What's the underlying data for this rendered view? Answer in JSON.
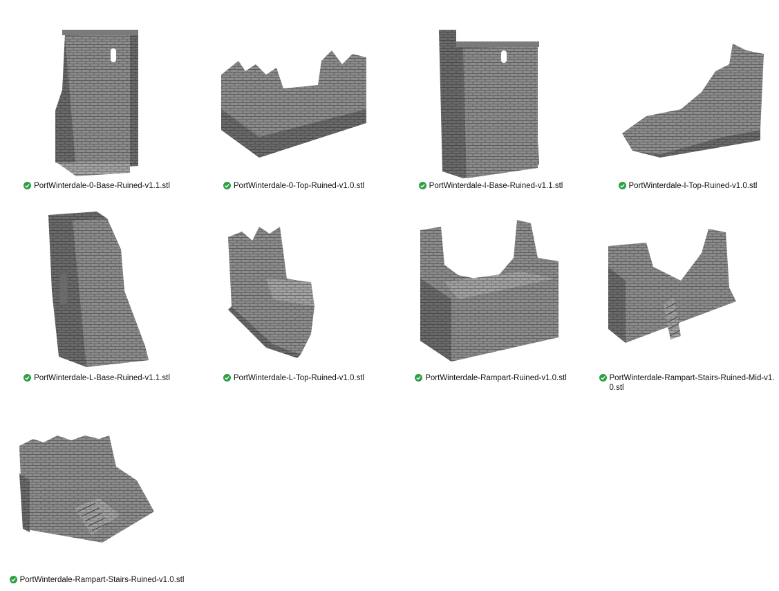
{
  "files": [
    {
      "name": "PortWinterdale-0-Base-Ruined-v1.1.stl",
      "status": "synced",
      "icon": "stone-tower-base-thumbnail-icon"
    },
    {
      "name": "PortWinterdale-0-Top-Ruined-v1.0.stl",
      "status": "synced",
      "icon": "crenellated-wall-top-thumbnail-icon"
    },
    {
      "name": "PortWinterdale-I-Base-Ruined-v1.1.stl",
      "status": "synced",
      "icon": "stone-tower-base-thumbnail-icon"
    },
    {
      "name": "PortWinterdale-I-Top-Ruined-v1.0.stl",
      "status": "synced",
      "icon": "ruined-wall-top-thumbnail-icon"
    },
    {
      "name": "PortWinterdale-L-Base-Ruined-v1.1.stl",
      "status": "synced",
      "icon": "stone-tower-base-thumbnail-icon"
    },
    {
      "name": "PortWinterdale-L-Top-Ruined-v1.0.stl",
      "status": "synced",
      "icon": "crenellated-corner-top-thumbnail-icon"
    },
    {
      "name": "PortWinterdale-Rampart-Ruined-v1.0.stl",
      "status": "synced",
      "icon": "rampart-thumbnail-icon"
    },
    {
      "name": "PortWinterdale-Rampart-Stairs-Ruined-Mid-v1.0.stl",
      "status": "synced",
      "icon": "rampart-stairs-thumbnail-icon"
    },
    {
      "name": "PortWinterdale-Rampart-Stairs-Ruined-v1.0.stl",
      "status": "synced",
      "icon": "rampart-stairs-thumbnail-icon"
    }
  ],
  "colors": {
    "status_ok": "#2ea043",
    "stone_light": "#9a9a9a",
    "stone_mid": "#7f7f7f",
    "stone_dark": "#555555"
  }
}
